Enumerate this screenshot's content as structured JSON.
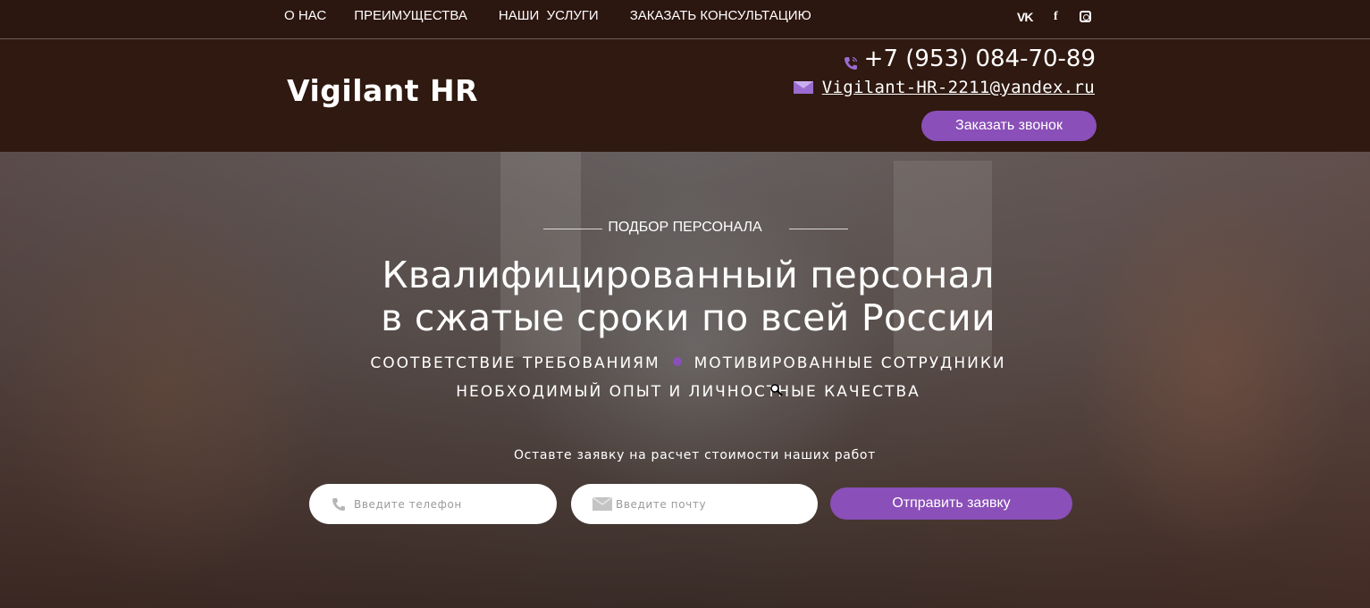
{
  "nav": {
    "items": [
      {
        "label": "О НАС"
      },
      {
        "label": "ПРЕИМУЩЕСТВА"
      },
      {
        "label": "НАШИ  УСЛУГИ"
      },
      {
        "label": "ЗАКАЗАТЬ КОНСУЛЬТАЦИЮ"
      }
    ],
    "social": {
      "vk": "VK",
      "facebook": "f",
      "instagram_icon": "instagram-icon"
    }
  },
  "header": {
    "logo": "Vigilant HR",
    "phone": "+7 (953) 084-70-89",
    "email": "Vigilant-HR-2211@yandex.ru",
    "call_button": "Заказать звонок"
  },
  "hero": {
    "kicker": "ПОДБОР ПЕРСОНАЛА",
    "title_line1": "Квалифицированный персонал",
    "title_line2": "в сжатые сроки по всей России",
    "feature1": "СООТВЕТСТВИЕ ТРЕБОВАНИЯМ",
    "feature2": "МОТИВИРОВАННЫЕ СОТРУДНИКИ",
    "feature3": "НЕОБХОДИМЫЙ ОПЫТ И ЛИЧНОСТНЫЕ КАЧЕСТВА",
    "cta_text": "Оставте заявку на расчет стоимости наших работ",
    "phone_placeholder": "Введите телефон",
    "email_placeholder": "Введите почту",
    "submit_label": "Отправить заявку"
  },
  "colors": {
    "accent": "#8a4fb8",
    "header_bg": "#2f1910"
  }
}
